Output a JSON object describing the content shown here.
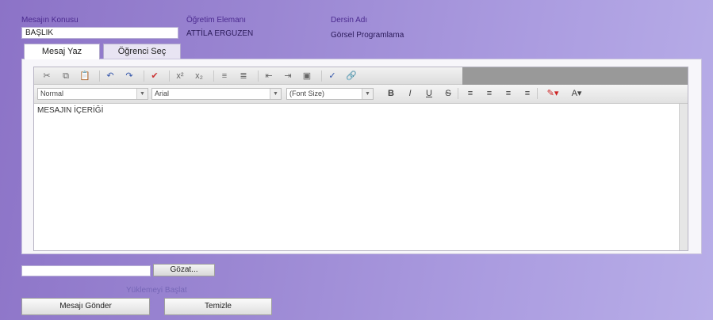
{
  "header": {
    "subject_label": "Mesajın Konusu",
    "subject_value": "BAŞLIK",
    "instructor_label": "Öğretim Elemanı",
    "instructor_value": "ATTİLA ERGUZEN",
    "course_label": "Dersin Adı",
    "course_value": "Görsel Programlama"
  },
  "tabs": [
    {
      "label": "Mesaj Yaz",
      "active": true
    },
    {
      "label": "Öğrenci Seç",
      "active": false
    }
  ],
  "editor": {
    "toolbar1": [
      {
        "icon": "cut-icon",
        "glyph": "✂"
      },
      {
        "icon": "copy-icon",
        "glyph": "⧉"
      },
      {
        "icon": "paste-icon",
        "glyph": "📋"
      },
      {
        "icon": "undo-icon",
        "glyph": "↶"
      },
      {
        "icon": "redo-icon",
        "glyph": "↷"
      },
      {
        "icon": "spellcheck-icon",
        "glyph": "✔"
      },
      {
        "icon": "superscript-icon",
        "glyph": "x²"
      },
      {
        "icon": "subscript-icon",
        "glyph": "x₂"
      },
      {
        "icon": "ordered-list-icon",
        "glyph": "≡"
      },
      {
        "icon": "unordered-list-icon",
        "glyph": "≣"
      },
      {
        "icon": "outdent-icon",
        "glyph": "⇤"
      },
      {
        "icon": "indent-icon",
        "glyph": "⇥"
      },
      {
        "icon": "image-icon",
        "glyph": "▣"
      },
      {
        "icon": "check-icon",
        "glyph": "✓"
      },
      {
        "icon": "link-icon",
        "glyph": "🔗"
      }
    ],
    "format_value": "Normal",
    "font_value": "Arial",
    "size_value": "(Font Size)",
    "toolbar2": [
      {
        "icon": "bold-icon",
        "glyph": "B"
      },
      {
        "icon": "italic-icon",
        "glyph": "I"
      },
      {
        "icon": "underline-icon",
        "glyph": "U"
      },
      {
        "icon": "strikethrough-icon",
        "glyph": "S"
      },
      {
        "icon": "align-left-icon",
        "glyph": "≡"
      },
      {
        "icon": "align-center-icon",
        "glyph": "≡"
      },
      {
        "icon": "align-right-icon",
        "glyph": "≡"
      },
      {
        "icon": "align-justify-icon",
        "glyph": "≡"
      },
      {
        "icon": "highlight-color-icon",
        "glyph": "✎▾"
      },
      {
        "icon": "font-color-icon",
        "glyph": "A▾"
      }
    ],
    "content": "MESAJIN İÇERİĞİ"
  },
  "upload": {
    "browse_label": "Gözat...",
    "start_label": "Yüklemeyi Başlat"
  },
  "actions": {
    "send_label": "Mesajı Gönder",
    "clear_label": "Temizle"
  },
  "colors": {
    "label": "#4b2a8f",
    "background_start": "#8c73c7",
    "background_end": "#b8aee8"
  }
}
